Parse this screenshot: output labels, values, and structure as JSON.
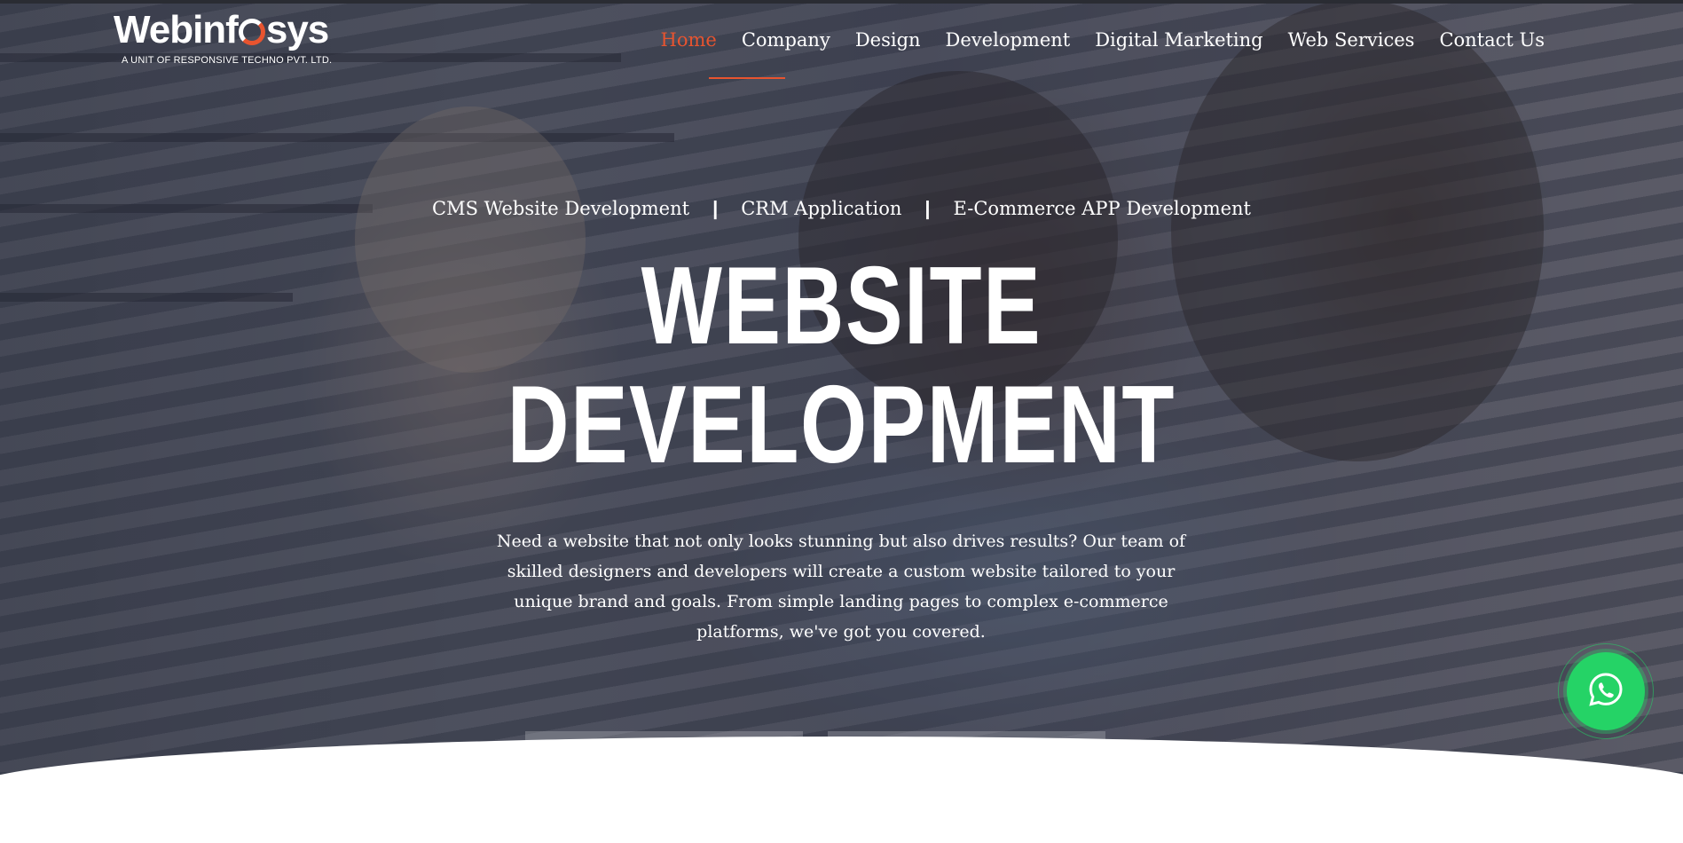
{
  "logo": {
    "brand_part1": "Webinf",
    "brand_part2": "sys",
    "tagline": "A UNIT OF RESPONSIVE TECHNO PVT. LTD."
  },
  "nav": {
    "items": [
      {
        "label": "Home",
        "active": true
      },
      {
        "label": "Company"
      },
      {
        "label": "Design"
      },
      {
        "label": "Development"
      },
      {
        "label": "Digital Marketing"
      },
      {
        "label": "Web Services"
      },
      {
        "label": "Contact Us"
      }
    ]
  },
  "hero": {
    "services": [
      "CMS Website Development",
      "CRM Application",
      "E-Commerce APP Development"
    ],
    "separator": "|",
    "headline_line1": "WEBSITE",
    "headline_line2": "DEVELOPMENT",
    "description": "Need a website that not only looks stunning but also drives results? Our team of skilled designers and developers will create a custom website tailored to your unique brand and goals. From simple landing pages to complex e-commerce platforms, we've got you covered."
  },
  "floating": {
    "whatsapp_icon": "whatsapp-icon"
  },
  "colors": {
    "accent": "#e8542f",
    "whatsapp": "#25d366",
    "text": "#ffffff"
  }
}
